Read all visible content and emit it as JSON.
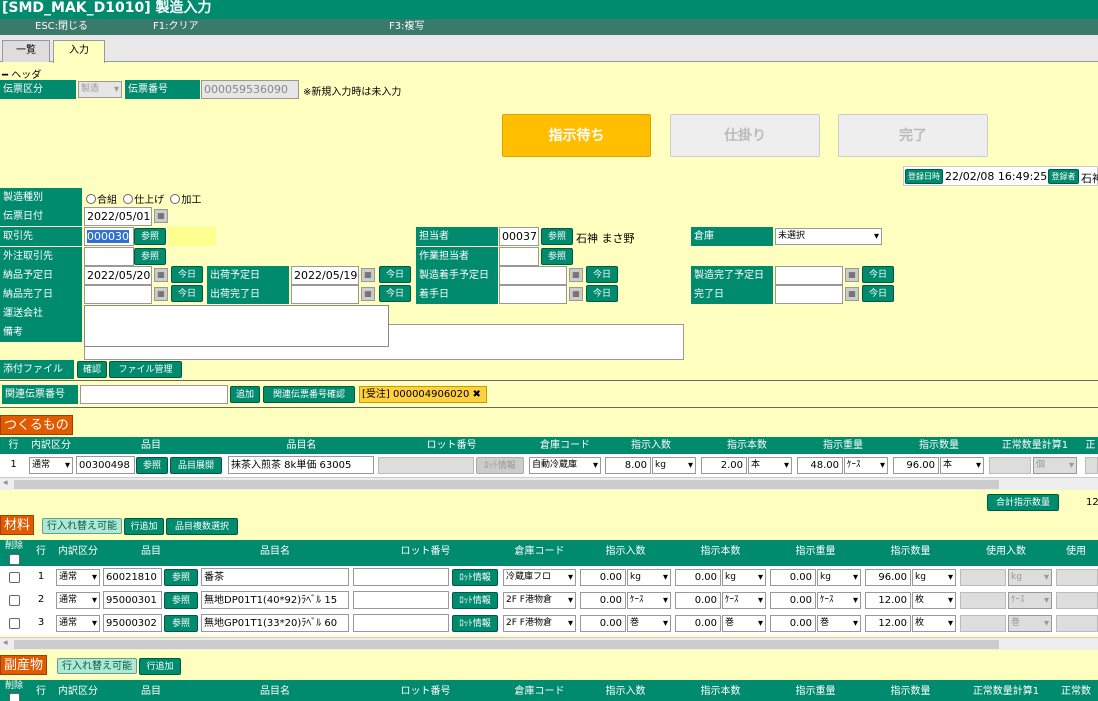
{
  "window": {
    "title": "[SMD_MAK_D1010] 製造入力"
  },
  "fkeys": {
    "esc": "ESC:閉じる",
    "f1": "F1:クリア",
    "f3": "F3:複写"
  },
  "tabs": {
    "list": "一覧",
    "input": "入力"
  },
  "header_section": {
    "toggle": "━ ヘッダ"
  },
  "slip": {
    "kubun_label": "伝票区分",
    "kubun_value": "製造",
    "no_label": "伝票番号",
    "no_value": "000059536090",
    "note": "※新規入力時は未入力"
  },
  "status": {
    "waiting": "指示待ち",
    "wip": "仕掛り",
    "done": "完了"
  },
  "reg": {
    "date_label": "登録日時",
    "date_value": "22/02/08 16:49:25",
    "user_label": "登録者",
    "user_value": "石神"
  },
  "form": {
    "type_label": "製造種別",
    "type_opts": [
      "合組",
      "仕上げ",
      "加工"
    ],
    "date_label": "伝票日付",
    "date_value": "2022/05/01",
    "client_label": "取引先",
    "client_value": "000030",
    "ref": "参照",
    "subcon_label": "外注取引先",
    "deliv_plan_label": "納品予定日",
    "deliv_plan_value": "2022/05/20",
    "today": "今日",
    "deliv_done_label": "納品完了日",
    "carrier_label": "運送会社",
    "memo_label": "備考",
    "ship_plan_label": "出荷予定日",
    "ship_plan_value": "2022/05/19",
    "ship_done_label": "出荷完了日",
    "staff_label": "担当者",
    "staff_code": "00037",
    "staff_name": "石神 まさ野",
    "work_staff_label": "作業担当者",
    "start_plan_label": "製造着手予定日",
    "start_label": "着手日",
    "wh_label": "倉庫",
    "wh_value": "未選択",
    "finish_plan_label": "製造完了予定日",
    "finish_label": "完了日"
  },
  "attach": {
    "label": "添付ファイル",
    "confirm": "確認",
    "manage": "ファイル管理"
  },
  "related": {
    "label": "関連伝票番号",
    "add": "追加",
    "check": "関連伝票番号確認",
    "tag": "[受注] 000004906020"
  },
  "make": {
    "title": "つくるもの",
    "headers": [
      "行",
      "内訳区分",
      "品目",
      "品目名",
      "ロット番号",
      "倉庫コード",
      "指示入数",
      "指示本数",
      "指示重量",
      "指示数量",
      "正常数量計算1",
      "正"
    ],
    "row": {
      "no": "1",
      "kubun": "通常",
      "code": "00300498",
      "ref": "参照",
      "expand": "品目展開",
      "name": "抹茶入煎茶 8k単価 63005",
      "lot_btn": "ﾛｯﾄ情報",
      "wh": "自動冷蔵庫",
      "in_qty": "8.00",
      "in_unit": "kg",
      "cnt": "2.00",
      "cnt_unit": "本",
      "wt": "48.00",
      "wt_unit": "ｹｰｽ",
      "qty": "96.00",
      "qty_unit": "本",
      "calc_unit": "個"
    },
    "total_btn": "合計指示数量",
    "total_val": "12"
  },
  "material": {
    "title": "材料",
    "swap": "行入れ替え可能",
    "add_row": "行追加",
    "multi": "品目複数選択",
    "headers": [
      "削除",
      "行",
      "内訳区分",
      "品目",
      "品目名",
      "ロット番号",
      "倉庫コード",
      "指示入数",
      "指示本数",
      "指示重量",
      "指示数量",
      "使用入数",
      "使用"
    ],
    "rows": [
      {
        "no": "1",
        "kubun": "通常",
        "code": "60021810",
        "ref": "参照",
        "name": "番茶",
        "lot_btn": "ﾛｯﾄ情報",
        "wh": "冷蔵庫フロ",
        "in_qty": "0.00",
        "in_unit": "kg",
        "cnt": "0.00",
        "cnt_unit": "kg",
        "wt": "0.00",
        "wt_unit": "kg",
        "qty": "96.00",
        "qty_unit": "kg",
        "use_unit": "kg"
      },
      {
        "no": "2",
        "kubun": "通常",
        "code": "95000301",
        "ref": "参照",
        "name": "無地DP01T1(40*92)ﾗﾍﾞﾙ 15",
        "lot_btn": "ﾛｯﾄ情報",
        "wh": "2F F港物倉",
        "in_qty": "0.00",
        "in_unit": "ｹｰｽ",
        "cnt": "0.00",
        "cnt_unit": "ｹｰｽ",
        "wt": "0.00",
        "wt_unit": "ｹｰｽ",
        "qty": "12.00",
        "qty_unit": "枚",
        "use_unit": "ｹｰｽ"
      },
      {
        "no": "3",
        "kubun": "通常",
        "code": "95000302",
        "ref": "参照",
        "name": "無地GP01T1(33*20)ﾗﾍﾞﾙ 60",
        "lot_btn": "ﾛｯﾄ情報",
        "wh": "2F F港物倉",
        "in_qty": "0.00",
        "in_unit": "巻",
        "cnt": "0.00",
        "cnt_unit": "巻",
        "wt": "0.00",
        "wt_unit": "巻",
        "qty": "12.00",
        "qty_unit": "枚",
        "use_unit": "巻"
      }
    ]
  },
  "byproduct": {
    "title": "副産物",
    "swap": "行入れ替え可能",
    "add_row": "行追加",
    "headers": [
      "削除",
      "行",
      "内訳区分",
      "品目",
      "品目名",
      "ロット番号",
      "倉庫コード",
      "指示入数",
      "指示本数",
      "指示重量",
      "指示数量",
      "正常数量計算1",
      "正常数"
    ]
  }
}
